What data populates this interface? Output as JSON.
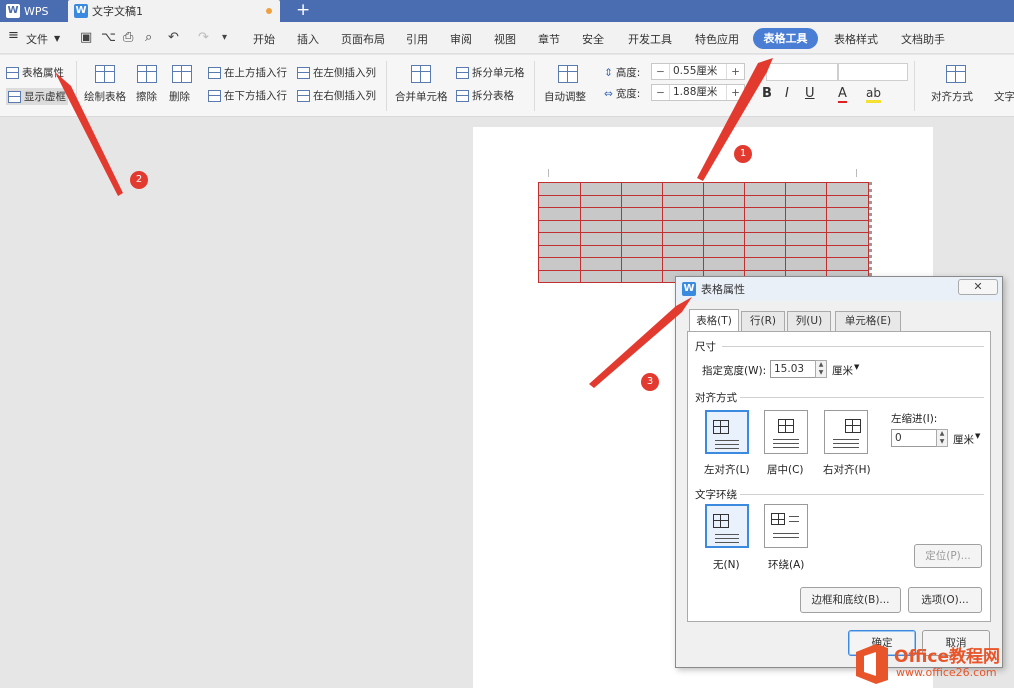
{
  "titlebar": {
    "app": "WPS",
    "doc_tab": "文字文稿1",
    "new_tab": "+"
  },
  "menu": {
    "file": "文件",
    "items": [
      "开始",
      "插入",
      "页面布局",
      "引用",
      "审阅",
      "视图",
      "章节",
      "安全",
      "开发工具",
      "特色应用",
      "表格工具",
      "表格样式",
      "文档助手"
    ],
    "active": "表格工具"
  },
  "ribbon": {
    "table_props": "表格属性",
    "show_virtual": "显示虚框",
    "draw_table": "绘制表格",
    "erase": "擦除",
    "delete": "删除",
    "insert_above": "在上方插入行",
    "insert_below": "在下方插入行",
    "insert_left": "在左侧插入列",
    "insert_right": "在右侧插入列",
    "merge": "合并单元格",
    "split_cell": "拆分单元格",
    "split_table": "拆分表格",
    "autofit": "自动调整",
    "height_label": "高度:",
    "height_value": "0.55厘米",
    "width_label": "宽度:",
    "width_value": "1.88厘米",
    "align": "对齐方式",
    "text": "文字",
    "bold": "B",
    "italic": "I",
    "underline": "U",
    "font_color": "A"
  },
  "dialog": {
    "title": "表格属性",
    "tabs": [
      "表格(T)",
      "行(R)",
      "列(U)",
      "单元格(E)"
    ],
    "size_group": "尺寸",
    "width_label": "指定宽度(W):",
    "width_value": "15.03",
    "unit": "厘米",
    "align_group": "对齐方式",
    "align_left": "左对齐(L)",
    "align_center": "居中(C)",
    "align_right": "右对齐(H)",
    "indent_label": "左缩进(I):",
    "indent_value": "0",
    "indent_unit": "厘米",
    "wrap_group": "文字环绕",
    "wrap_none": "无(N)",
    "wrap_around": "环绕(A)",
    "position_btn": "定位(P)...",
    "borders_btn": "边框和底纹(B)...",
    "options_btn": "选项(O)...",
    "ok": "确定",
    "cancel": "取消"
  },
  "annotations": {
    "one": "1",
    "two": "2",
    "three": "3",
    "color": "#e23a2f"
  },
  "watermark": {
    "brand": "Office教程网",
    "url": "www.office26.com"
  }
}
